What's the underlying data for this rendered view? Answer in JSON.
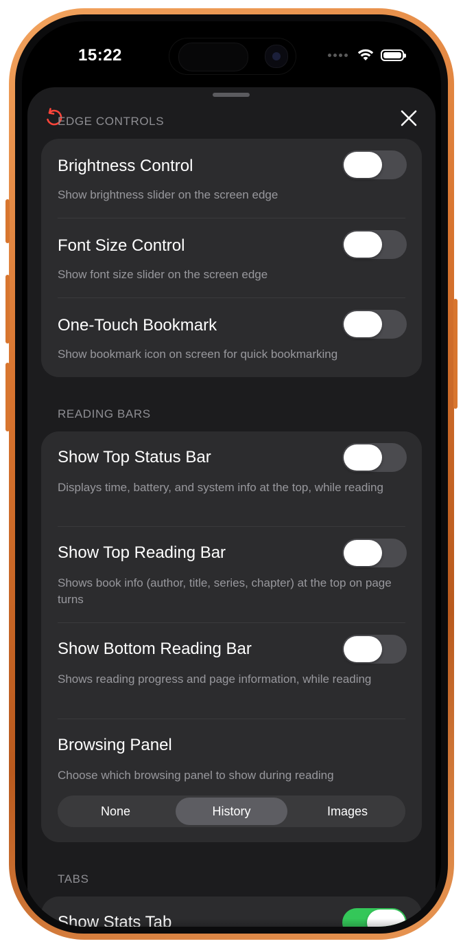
{
  "status_bar": {
    "time": "15:22"
  },
  "sheet": {
    "sections": {
      "edge_controls": "EDGE CONTROLS",
      "reading_bars": "READING BARS",
      "tabs": "TABS"
    },
    "edge_controls": [
      {
        "title": "Brightness Control",
        "desc": "Show brightness slider on the screen edge",
        "on": false
      },
      {
        "title": "Font Size Control",
        "desc": "Show font size slider on the screen edge",
        "on": false
      },
      {
        "title": "One-Touch Bookmark",
        "desc": "Show bookmark icon on screen for quick bookmarking",
        "on": false
      }
    ],
    "reading_bars": [
      {
        "title": "Show Top Status Bar",
        "desc": "Displays time, battery, and system info at the top, while reading",
        "on": false
      },
      {
        "title": "Show Top Reading Bar",
        "desc": "Shows book info (author, title, series, chapter) at the top on page turns",
        "on": false
      },
      {
        "title": "Show Bottom Reading Bar",
        "desc": "Shows reading progress and page information, while reading",
        "on": false
      }
    ],
    "browsing_panel": {
      "title": "Browsing Panel",
      "desc": "Choose which browsing panel to show during reading",
      "options": [
        "None",
        "History",
        "Images"
      ],
      "selected": "History"
    },
    "tabs": [
      {
        "title": "Show Stats Tab",
        "on": true
      }
    ]
  },
  "colors": {
    "accent_reset": "#ff453a",
    "toggle_on": "#34c759",
    "frame": "#d8742f"
  },
  "icons": {
    "reset": "counterclockwise-arrow-icon",
    "close": "close-x-icon",
    "wifi": "wifi-icon",
    "battery": "battery-icon"
  }
}
